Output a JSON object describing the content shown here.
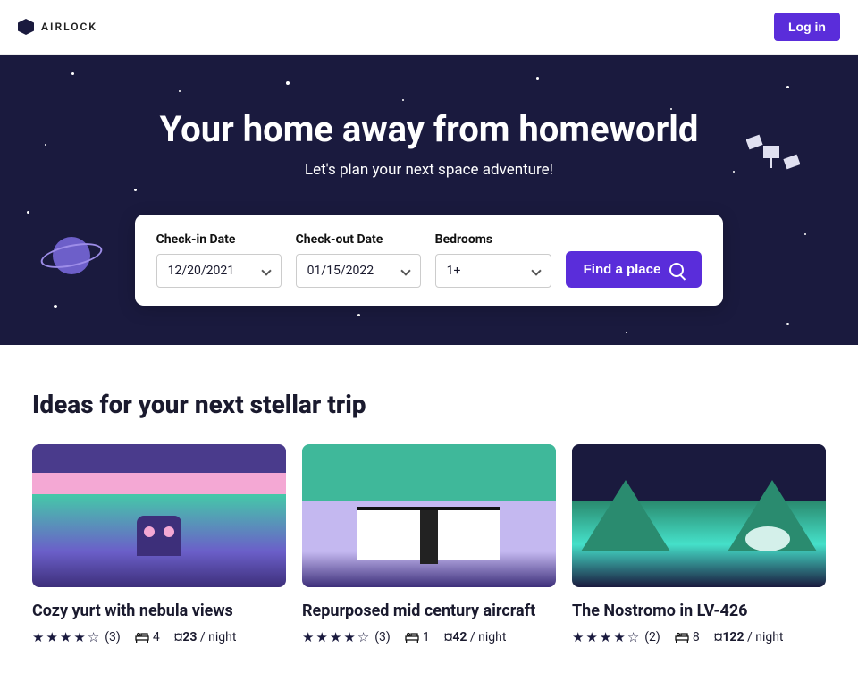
{
  "brand": "AIRLOCK",
  "login_label": "Log in",
  "hero": {
    "title": "Your home away from homeworld",
    "subtitle": "Let's plan your next space adventure!"
  },
  "search": {
    "checkin_label": "Check-in Date",
    "checkin_value": "12/20/2021",
    "checkout_label": "Check-out Date",
    "checkout_value": "01/15/2022",
    "bedrooms_label": "Bedrooms",
    "bedrooms_value": "1+",
    "button_label": "Find a place"
  },
  "section_title": "Ideas for your next stellar trip",
  "listings": [
    {
      "title": "Cozy yurt with nebula views",
      "rating": 4,
      "reviews": "(3)",
      "beds": "4",
      "price": "¤23",
      "per": " / night"
    },
    {
      "title": "Repurposed mid century aircraft",
      "rating": 4,
      "reviews": "(3)",
      "beds": "1",
      "price": "¤42",
      "per": " / night"
    },
    {
      "title": "The Nostromo in LV-426",
      "rating": 4,
      "reviews": "(2)",
      "beds": "8",
      "price": "¤122",
      "per": " / night"
    }
  ]
}
